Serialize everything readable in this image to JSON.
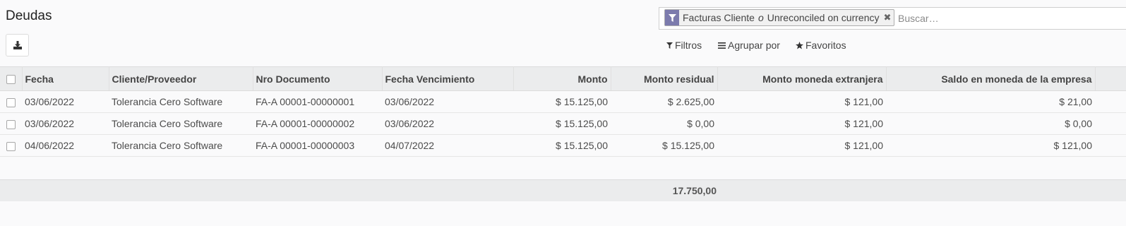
{
  "page": {
    "title": "Deudas"
  },
  "search": {
    "facet_label_1": "Facturas Cliente",
    "facet_separator": "o",
    "facet_label_2": "Unreconciled on currency",
    "placeholder": "Buscar…"
  },
  "controls": {
    "filters": "Filtros",
    "group_by": "Agrupar por",
    "favorites": "Favoritos"
  },
  "table": {
    "columns": [
      "Fecha",
      "Cliente/Proveedor",
      "Nro Documento",
      "Fecha Vencimiento",
      "Monto",
      "Monto residual",
      "Monto moneda extranjera",
      "Saldo en moneda de la empresa"
    ],
    "rows": [
      [
        "03/06/2022",
        "Tolerancia Cero Software",
        "FA-A 00001-00000001",
        "03/06/2022",
        "$ 15.125,00",
        "$ 2.625,00",
        "$ 121,00",
        "$ 21,00"
      ],
      [
        "03/06/2022",
        "Tolerancia Cero Software",
        "FA-A 00001-00000002",
        "03/06/2022",
        "$ 15.125,00",
        "$ 0,00",
        "$ 121,00",
        "$ 0,00"
      ],
      [
        "04/06/2022",
        "Tolerancia Cero Software",
        "FA-A 00001-00000003",
        "04/07/2022",
        "$ 15.125,00",
        "$ 15.125,00",
        "$ 121,00",
        "$ 121,00"
      ]
    ],
    "total_residual": "17.750,00"
  },
  "colors": {
    "facet_accent": "#7c7bad",
    "header_bg": "#ebeced"
  },
  "icons": {
    "download": "download-icon",
    "filter": "filter-icon",
    "group": "list-icon",
    "favorite": "star-icon",
    "remove": "close-icon"
  }
}
